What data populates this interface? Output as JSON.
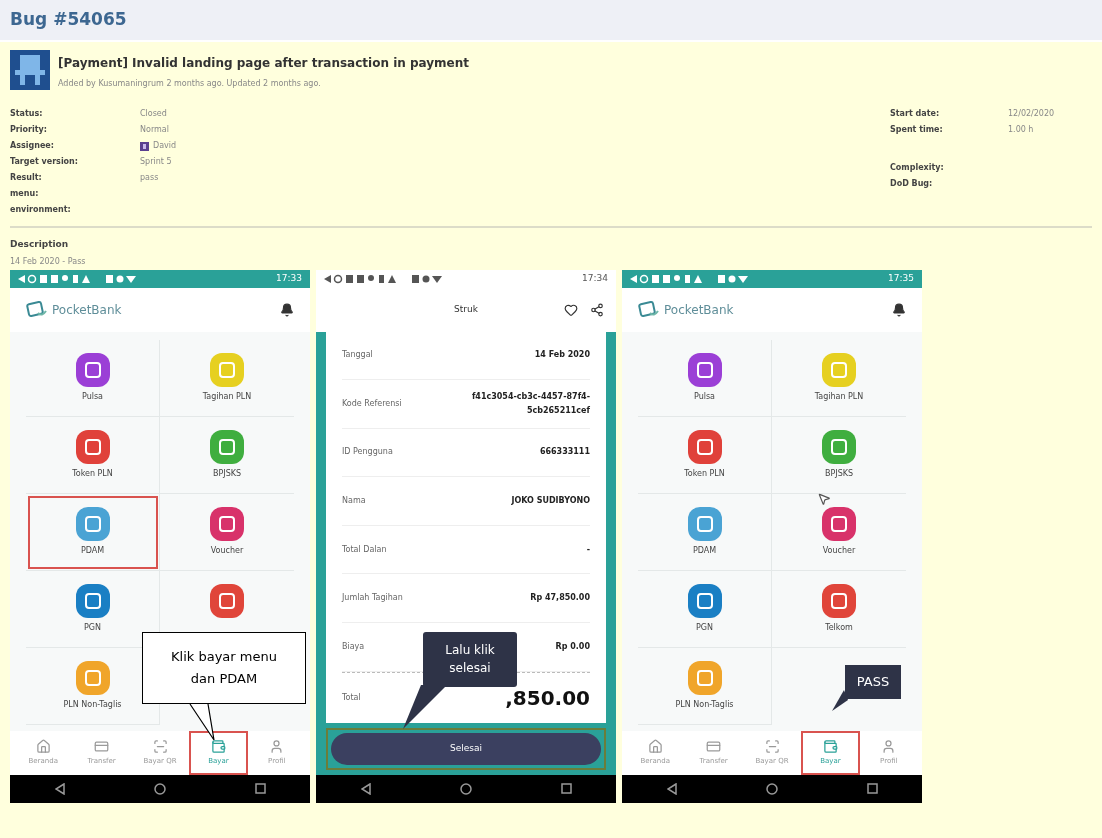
{
  "page": {
    "heading": "Bug #54065"
  },
  "issue": {
    "title": "[Payment] Invalid landing page after transaction in payment",
    "meta": "Added by Kusumaningrum 2 months ago. Updated 2 months ago.",
    "attributes_left": [
      {
        "label": "Status:",
        "value": "Closed",
        "kind": "text"
      },
      {
        "label": "Priority:",
        "value": "Normal",
        "kind": "text"
      },
      {
        "label": "Assignee:",
        "value": "David",
        "kind": "user"
      },
      {
        "label": "Target version:",
        "value": "Sprint 5",
        "kind": "text"
      },
      {
        "label": "Result:",
        "value": "pass",
        "kind": "text"
      },
      {
        "label": "menu:",
        "kind": "text"
      },
      {
        "label": "environment:",
        "kind": "text"
      }
    ],
    "attributes_right": [
      [
        {
          "label": "Start date:",
          "value": "12/02/2020"
        },
        {
          "label": "Spent time:",
          "value": "1.00 h"
        }
      ],
      [
        {
          "label": "Complexity:"
        },
        {
          "label": "DoD Bug:"
        }
      ]
    ]
  },
  "description": {
    "heading": "Description",
    "text": "14 Feb 2020 - Pass"
  },
  "screens": [
    {
      "kind": "menu",
      "status_bar": {
        "time": "17:33"
      },
      "brand": "PocketBank",
      "tiles": [
        {
          "label": "Pulsa",
          "color": "#9b3fd6",
          "highlighted": false
        },
        {
          "label": "Tagihan PLN",
          "color": "#e6d020",
          "highlighted": false
        },
        {
          "label": "Token PLN",
          "color": "#e0413a",
          "highlighted": false
        },
        {
          "label": "BPJSKS",
          "color": "#3fae3f",
          "highlighted": false
        },
        {
          "label": "PDAM",
          "color": "#4aa3d4",
          "highlighted": true
        },
        {
          "label": "Voucher",
          "color": "#d8326a",
          "highlighted": false
        },
        {
          "label": "PGN",
          "color": "#1a7fc4",
          "highlighted": false
        },
        {
          "color": "#e0453a",
          "highlighted": false
        },
        {
          "label": "PLN Non-Taglis",
          "color": "#f0a52a",
          "highlighted": false
        }
      ],
      "nav": [
        {
          "label": "Beranda",
          "selected": false,
          "highlighted": false
        },
        {
          "label": "Transfer",
          "selected": false,
          "highlighted": false
        },
        {
          "label": "Bayar QR",
          "selected": false,
          "highlighted": false
        },
        {
          "label": "Bayar",
          "selected": true,
          "highlighted": true
        },
        {
          "label": "Profil",
          "selected": false,
          "highlighted": false
        }
      ],
      "callout": {
        "kind": "box",
        "text": "Klik bayar menu dan PDAM"
      }
    },
    {
      "kind": "receipt",
      "status_bar": {
        "time": "17:34"
      },
      "title": "Struk",
      "rows": [
        {
          "label": "Tanggal",
          "value": "14 Feb 2020"
        },
        {
          "label": "Kode Referensi",
          "value": "f41c3054-cb3c-4457-87f4-5cb265211cef"
        },
        {
          "label": "ID Pengguna",
          "value": "666333111"
        },
        {
          "label": "Nama",
          "value": "JOKO SUDIBYONO"
        },
        {
          "label": "Total Dalan",
          "value": "-"
        },
        {
          "label": "Jumlah Tagihan",
          "value": "Rp 47,850.00"
        },
        {
          "label": "Biaya",
          "value": "Rp 0.00"
        }
      ],
      "total": {
        "label": "Total",
        "value": ",850.00"
      },
      "button": {
        "label": "Selesai",
        "highlighted": true
      },
      "callout": {
        "kind": "bubble",
        "text": "Lalu klik selesai"
      }
    },
    {
      "kind": "menu",
      "status_bar": {
        "time": "17:35"
      },
      "brand": "PocketBank",
      "tiles": [
        {
          "label": "Pulsa",
          "color": "#9b3fd6",
          "highlighted": false
        },
        {
          "label": "Tagihan PLN",
          "color": "#e6d020",
          "highlighted": false
        },
        {
          "label": "Token PLN",
          "color": "#e0413a",
          "highlighted": false
        },
        {
          "label": "BPJSKS",
          "color": "#3fae3f",
          "highlighted": false
        },
        {
          "label": "PDAM",
          "color": "#4aa3d4",
          "highlighted": false
        },
        {
          "label": "Voucher",
          "color": "#d8326a",
          "highlighted": false
        },
        {
          "label": "PGN",
          "color": "#1a7fc4",
          "highlighted": false
        },
        {
          "label": "Telkom",
          "color": "#e0453a",
          "highlighted": false
        },
        {
          "label": "PLN Non-Taglis",
          "color": "#f0a52a",
          "highlighted": false
        }
      ],
      "nav": [
        {
          "label": "Beranda",
          "selected": false,
          "highlighted": false
        },
        {
          "label": "Transfer",
          "selected": false,
          "highlighted": false
        },
        {
          "label": "Bayar QR",
          "selected": false,
          "highlighted": false
        },
        {
          "label": "Bayar",
          "selected": true,
          "highlighted": true
        },
        {
          "label": "Profil",
          "selected": false,
          "highlighted": false
        }
      ],
      "callout": {
        "kind": "tag",
        "text": "PASS"
      },
      "cursor": true
    }
  ]
}
